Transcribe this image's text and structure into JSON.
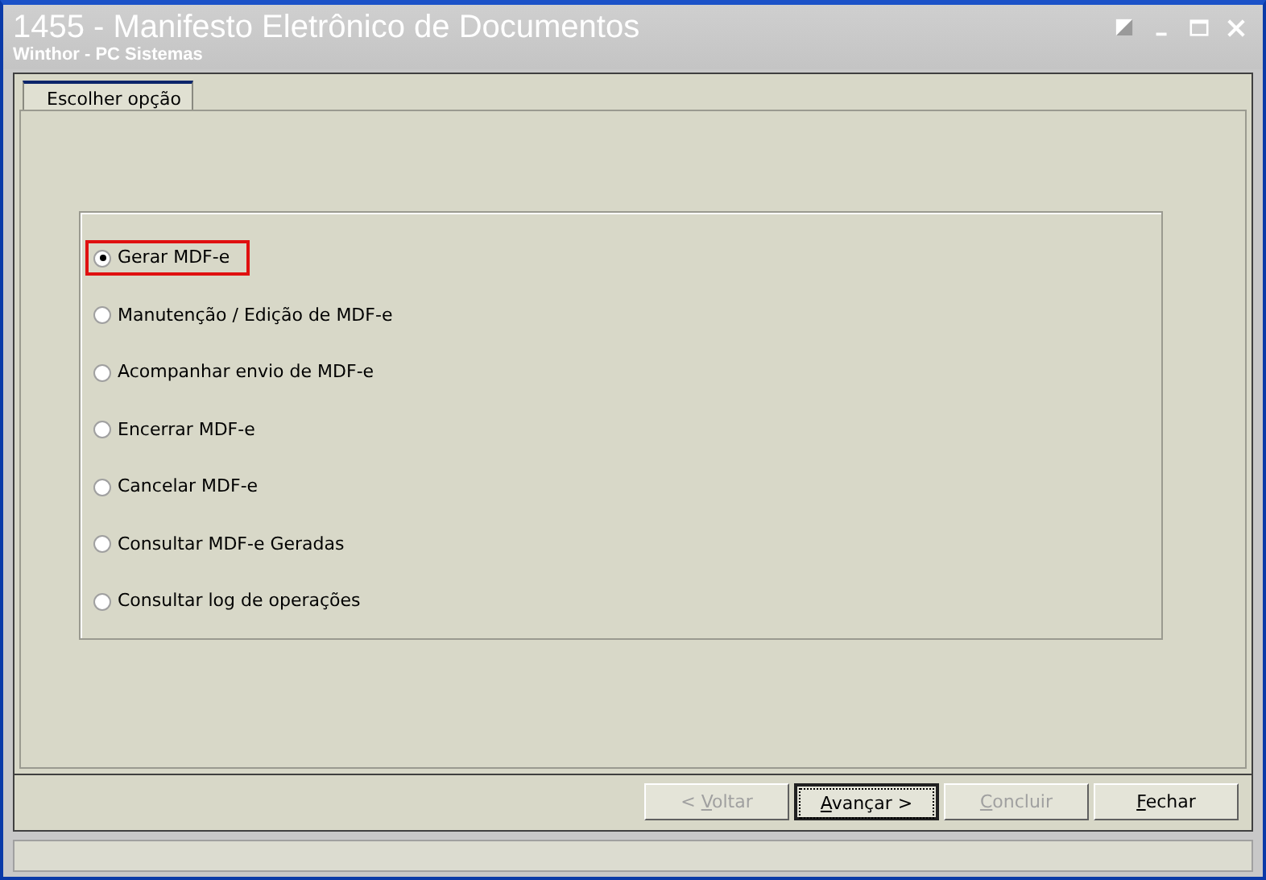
{
  "window": {
    "title": "1455 - Manifesto Eletrônico de Documentos",
    "subtitle": "Winthor - PC Sistemas"
  },
  "tabs": [
    {
      "label": "Escolher opção",
      "selected": true
    }
  ],
  "options": [
    {
      "label": "Gerar MDF-e",
      "selected": true,
      "highlighted": true
    },
    {
      "label": "Manutenção / Edição de MDF-e",
      "selected": false,
      "highlighted": false
    },
    {
      "label": "Acompanhar envio de MDF-e",
      "selected": false,
      "highlighted": false
    },
    {
      "label": "Encerrar MDF-e",
      "selected": false,
      "highlighted": false
    },
    {
      "label": "Cancelar MDF-e",
      "selected": false,
      "highlighted": false
    },
    {
      "label": "Consultar MDF-e Geradas",
      "selected": false,
      "highlighted": false
    },
    {
      "label": "Consultar log de operações",
      "selected": false,
      "highlighted": false
    }
  ],
  "buttons": [
    {
      "label_start": "< ",
      "access_key": "V",
      "label_end": "oltar",
      "disabled": true,
      "default": false
    },
    {
      "access_key": "A",
      "label_end": "vançar >",
      "disabled": false,
      "default": true
    },
    {
      "access_key": "C",
      "label_end": "oncluir",
      "disabled": true,
      "default": false
    },
    {
      "access_key": "F",
      "label_end": "echar",
      "disabled": false,
      "default": false
    }
  ]
}
